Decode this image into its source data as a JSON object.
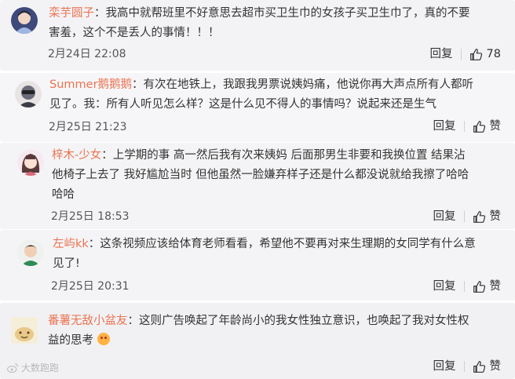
{
  "comments": [
    {
      "username": "栾芋圆子",
      "text_line1": "我高中就帮班里不好意思去超市买卫生巾的女孩子买卫生巾了，真的不要",
      "text_line2": "害羞，这个不是丢人的事情！！！",
      "time": "2月24日 22:08",
      "reply": "回复",
      "likes": "78"
    },
    {
      "username": "Summer鹅鹅鹅",
      "text_line1": "有次在地铁上，我跟我男票说姨妈痛，他说你再大声点所有人都听",
      "text_line2": "见了。我：所有人听见怎么样？这是什么见不得人的事情吗？说起来还是生气",
      "time": "2月25日 21:23",
      "reply": "回复",
      "likes": "赞"
    },
    {
      "username": "梓木-少女",
      "text_line1": "上学期的事 高一然后我有次来姨妈 后面那男生非要和我换位置 结果沾",
      "text_line2": "他椅子上去了 我好尴尬当时 但他虽然一脸嫌弃样子还是什么都没说就给我擦了哈哈",
      "text_line3": "哈哈",
      "time": "2月25日 18:53",
      "reply": "回复",
      "likes": "赞"
    },
    {
      "username": "左屿kk",
      "text_line1": "这条视频应该给体育老师看看，希望他不要再对来生理期的女同学有什么意",
      "text_line2": "见了!",
      "time": "2月25日 20:31",
      "reply": "回复",
      "likes": "赞"
    },
    {
      "username": "番薯无敌小盆友",
      "text_line1": "这则广告唤起了年龄尚小的我女性独立意识，也唤起了我对女性权",
      "text_line2": "益的思考",
      "reply": "回复",
      "likes": "赞"
    }
  ],
  "watermark": "大数跑跑",
  "colors": {
    "username": "#eb7350",
    "card_bg": "#f2f2f5",
    "text": "#333333"
  }
}
